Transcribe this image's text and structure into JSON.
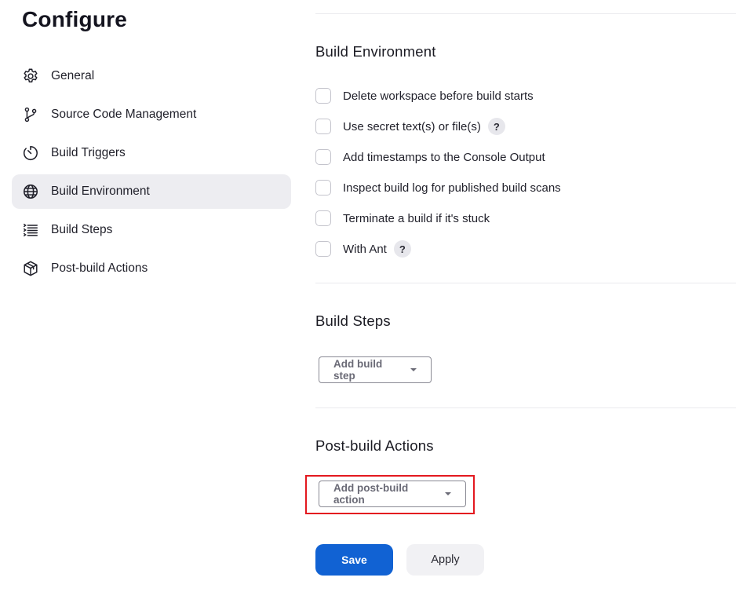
{
  "page": {
    "title": "Configure"
  },
  "sidebar": {
    "items": [
      {
        "label": "General",
        "icon": "gear-icon",
        "active": false
      },
      {
        "label": "Source Code Management",
        "icon": "git-branch-icon",
        "active": false
      },
      {
        "label": "Build Triggers",
        "icon": "timer-icon",
        "active": false
      },
      {
        "label": "Build Environment",
        "icon": "globe-icon",
        "active": true
      },
      {
        "label": "Build Steps",
        "icon": "list-icon",
        "active": false
      },
      {
        "label": "Post-build Actions",
        "icon": "cube-icon",
        "active": false
      }
    ]
  },
  "build_environment": {
    "title": "Build Environment",
    "options": [
      {
        "label": "Delete workspace before build starts",
        "checked": false,
        "help": false
      },
      {
        "label": "Use secret text(s) or file(s)",
        "checked": false,
        "help": true
      },
      {
        "label": "Add timestamps to the Console Output",
        "checked": false,
        "help": false
      },
      {
        "label": "Inspect build log for published build scans",
        "checked": false,
        "help": false
      },
      {
        "label": "Terminate a build if it's stuck",
        "checked": false,
        "help": false
      },
      {
        "label": "With Ant",
        "checked": false,
        "help": true
      }
    ],
    "help_glyph": "?"
  },
  "build_steps": {
    "title": "Build Steps",
    "add_button": "Add build step"
  },
  "post_build": {
    "title": "Post-build Actions",
    "add_button": "Add post-build action"
  },
  "actions": {
    "save_label": "Save",
    "apply_label": "Apply"
  },
  "colors": {
    "primary": "#1162d3",
    "highlight": "#e3181f",
    "active_bg": "#ededf1"
  }
}
